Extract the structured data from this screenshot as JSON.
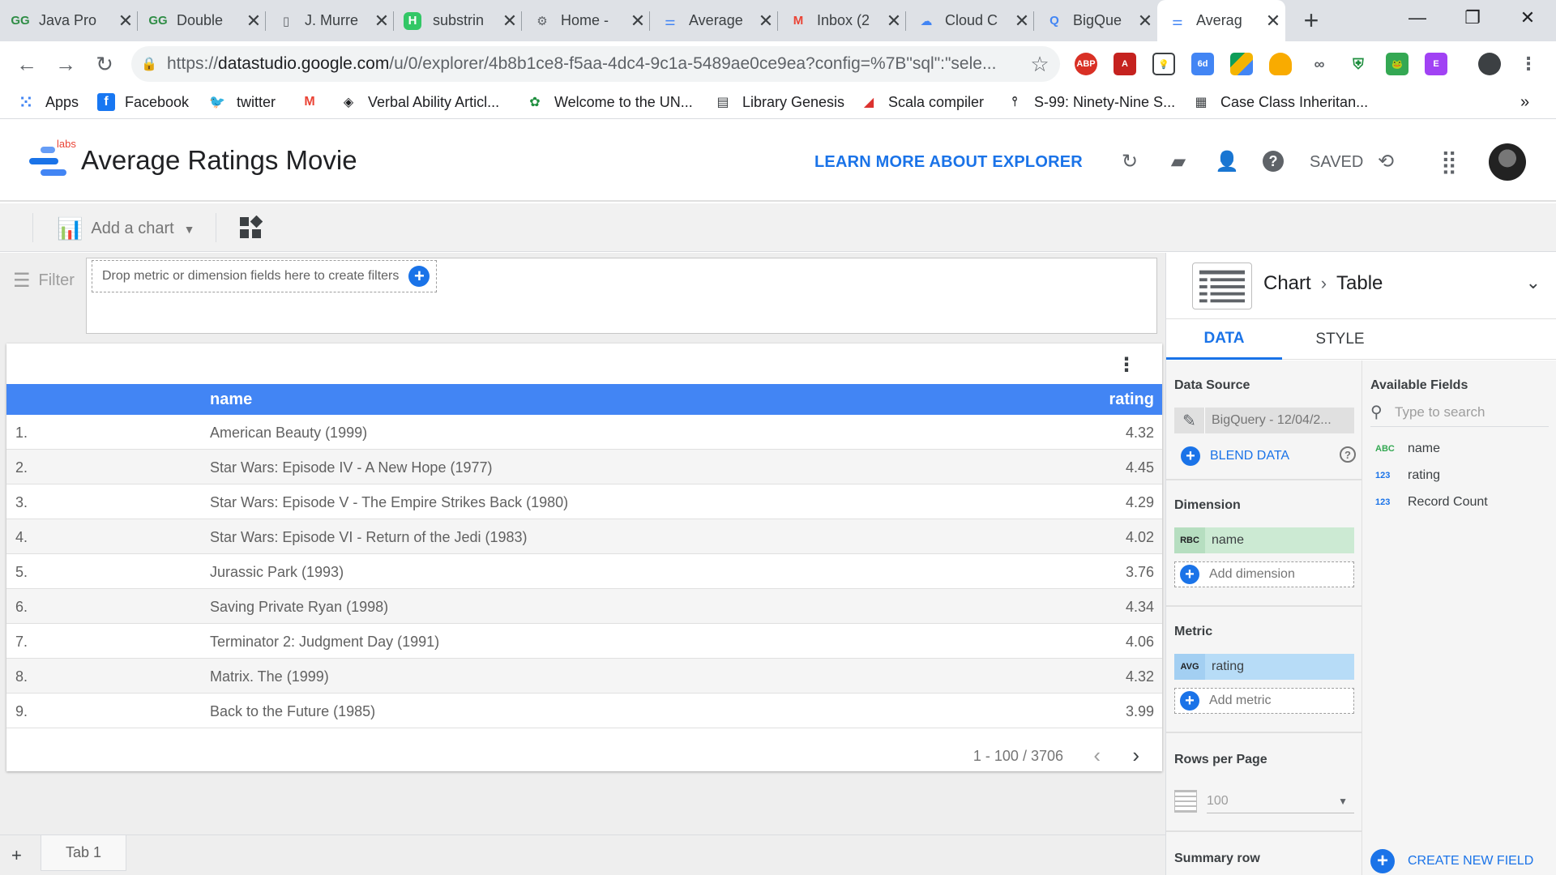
{
  "browser": {
    "tabs": [
      {
        "title": "Java Pro",
        "favicon": "GG",
        "color": "#2f8d46"
      },
      {
        "title": "Double",
        "favicon": "GG",
        "color": "#2f8d46"
      },
      {
        "title": "J. Murre",
        "favicon": "doc",
        "color": "#5f6368"
      },
      {
        "title": "substrin",
        "favicon": "H",
        "color": "#32c766"
      },
      {
        "title": "Home -",
        "favicon": "gear",
        "color": "#5f6368"
      },
      {
        "title": "Average",
        "favicon": "ds",
        "color": "#4285f4"
      },
      {
        "title": "Inbox (2",
        "favicon": "M",
        "color": "#ea4335"
      },
      {
        "title": "Cloud C",
        "favicon": "cloud",
        "color": "#4285f4"
      },
      {
        "title": "BigQue",
        "favicon": "bq",
        "color": "#4285f4"
      },
      {
        "title": "Averag",
        "favicon": "ds",
        "color": "#4285f4",
        "active": true
      }
    ],
    "url_prefix": "https://",
    "url_host": "datastudio.google.com",
    "url_path": "/u/0/explorer/4b8b1ce8-f5aa-4dc4-9c1a-5489ae0ce9ea?config=%7B\"sql\":\"sele...",
    "bookmarks": [
      {
        "label": "Apps",
        "icon": "apps-grid"
      },
      {
        "label": "Facebook",
        "icon": "facebook"
      },
      {
        "label": "twitter",
        "icon": "twitter"
      },
      {
        "label": "",
        "icon": "gmail"
      },
      {
        "label": "Verbal Ability Articl...",
        "icon": "diamond"
      },
      {
        "label": "Welcome to the UN...",
        "icon": "un"
      },
      {
        "label": "Library Genesis",
        "icon": "book"
      },
      {
        "label": "Scala compiler",
        "icon": "scala"
      },
      {
        "label": "S-99: Ninety-Nine S...",
        "icon": "pin"
      },
      {
        "label": "Case Class Inheritan...",
        "icon": "page"
      }
    ],
    "bookmarks_overflow": "»"
  },
  "header": {
    "labs": "labs",
    "title": "Average Ratings Movie",
    "learn_more": "LEARN MORE ABOUT EXPLORER",
    "saved": "SAVED"
  },
  "toolbar": {
    "add_chart": "Add a chart"
  },
  "filter": {
    "label": "Filter",
    "dropzone": "Drop metric or dimension fields here to create filters"
  },
  "table": {
    "columns": {
      "name": "name",
      "rating": "rating"
    },
    "rows": [
      {
        "idx": "1.",
        "name": "American Beauty (1999)",
        "rating": "4.32"
      },
      {
        "idx": "2.",
        "name": "Star Wars: Episode IV - A New Hope (1977)",
        "rating": "4.45"
      },
      {
        "idx": "3.",
        "name": "Star Wars: Episode V - The Empire Strikes Back (1980)",
        "rating": "4.29"
      },
      {
        "idx": "4.",
        "name": "Star Wars: Episode VI - Return of the Jedi (1983)",
        "rating": "4.02"
      },
      {
        "idx": "5.",
        "name": "Jurassic Park (1993)",
        "rating": "3.76"
      },
      {
        "idx": "6.",
        "name": "Saving Private Ryan (1998)",
        "rating": "4.34"
      },
      {
        "idx": "7.",
        "name": "Terminator 2: Judgment Day (1991)",
        "rating": "4.06"
      },
      {
        "idx": "8.",
        "name": "Matrix. The (1999)",
        "rating": "4.32"
      },
      {
        "idx": "9.",
        "name": "Back to the Future (1985)",
        "rating": "3.99"
      }
    ],
    "pager": "1 - 100 / 3706"
  },
  "pages": {
    "tab1": "Tab 1"
  },
  "panel": {
    "crumb_chart": "Chart",
    "crumb_type": "Table",
    "tab_data": "DATA",
    "tab_style": "STYLE",
    "data_source_label": "Data Source",
    "data_source_value": "BigQuery - 12/04/2...",
    "blend_data": "BLEND DATA",
    "dimension_label": "Dimension",
    "dimension_tag": "RBC",
    "dimension_value": "name",
    "add_dimension": "Add dimension",
    "metric_label": "Metric",
    "metric_tag": "AVG",
    "metric_value": "rating",
    "add_metric": "Add metric",
    "rows_per_page_label": "Rows per Page",
    "rows_per_page_value": "100",
    "summary_row_label": "Summary row",
    "available_fields_label": "Available Fields",
    "search_placeholder": "Type to search",
    "fields": [
      {
        "tag": "ABC",
        "name": "name"
      },
      {
        "tag": "123",
        "name": "rating"
      },
      {
        "tag": "123",
        "name": "Record Count"
      }
    ],
    "create_field": "CREATE NEW FIELD"
  },
  "colors": {
    "accent": "#1a73e8",
    "table_header": "#4285f4",
    "dimension_chip": "#ccead3",
    "metric_chip": "#b7dcf7"
  }
}
